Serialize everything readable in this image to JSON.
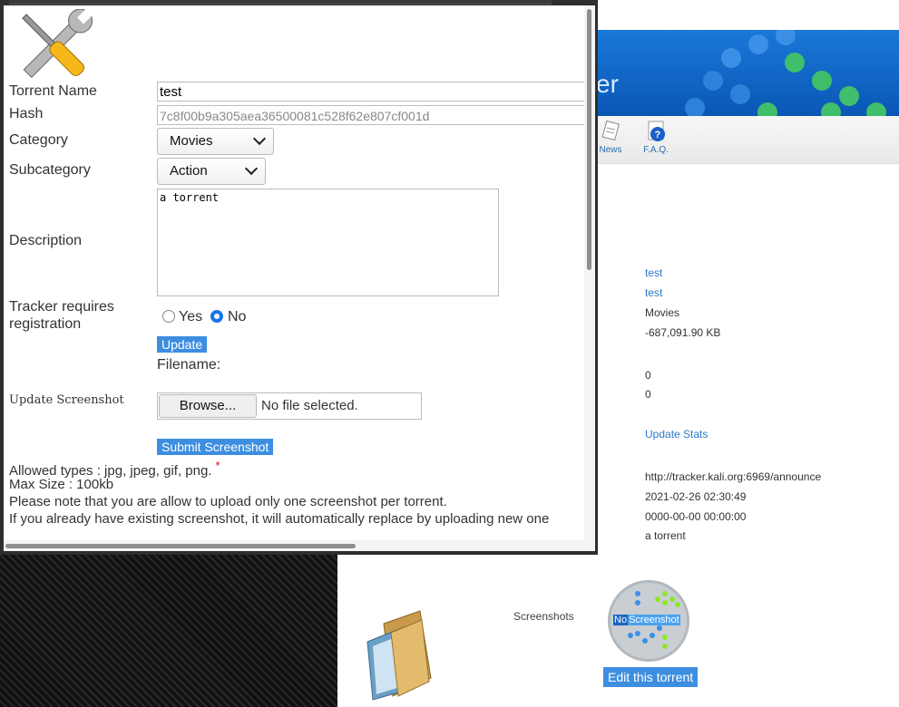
{
  "window": {
    "labels": {
      "torrent_name": "Torrent Name",
      "hash": "Hash",
      "category": "Category",
      "subcategory": "Subcategory",
      "description": "Description",
      "tracker_req_line1": "Tracker requires",
      "tracker_req_line2": "registration",
      "filename": "Filename:",
      "update_screenshot": "Update Screenshot"
    },
    "fields": {
      "torrent_name_value": "test",
      "hash_value": "7c8f00b9a305aea36500081c528f62e807cf001d",
      "category_selected": "Movies",
      "subcategory_selected": "Action",
      "description_value": "a torrent"
    },
    "radio": {
      "yes_label": "Yes",
      "no_label": "No",
      "selected": "No"
    },
    "buttons": {
      "update": "Update",
      "browse": "Browse...",
      "submit_screenshot": "Submit Screenshot"
    },
    "file": {
      "no_file_text": "No file selected."
    },
    "notes": {
      "allowed_types": "Allowed types : jpg, jpeg, gif, png.",
      "required_mark": "*",
      "max_size": "Max Size : 100kb",
      "one_screenshot": "Please note that you are allow to upload only one screenshot per torrent.",
      "replace_note": "If you already have existing screenshot, it will automatically replace by uploading new one"
    }
  },
  "background_page": {
    "banner_text": "er",
    "nav": {
      "news": "News",
      "faq": "F.A.Q."
    },
    "info": {
      "name": "test",
      "filename": "test",
      "category": "Movies",
      "size": "-687,091.90 KB",
      "seeders": "0",
      "leechers": "0",
      "update_stats": "Update Stats",
      "announce": "http://tracker.kali.org:6969/announce",
      "added": "2021-02-26 02:30:49",
      "last_update": "0000-00-00 00:00:00",
      "description": "a torrent"
    },
    "screenshots_label": "Screenshots",
    "no_screenshot": {
      "no": "No",
      "screenshot": "Screenshot"
    },
    "edit_button": "Edit this torrent"
  },
  "colors": {
    "accent_blue": "#3d8ee0",
    "radio_selected": "#1a73e8",
    "banner_blue": "#0a57b5",
    "link": "#2a78c8"
  }
}
